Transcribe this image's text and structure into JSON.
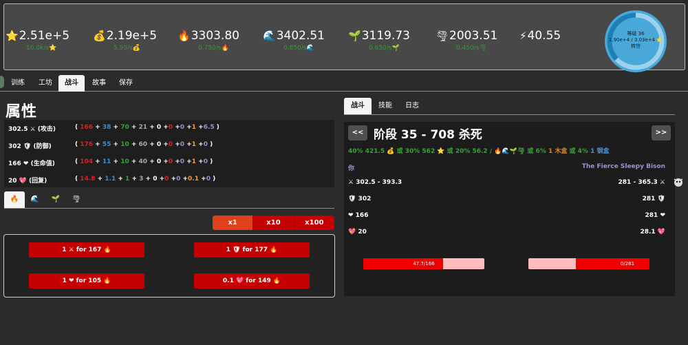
{
  "resources": [
    {
      "icon": "⭐",
      "value": "2.51e+5",
      "rate": "10.0k/s",
      "rate_icon": "⭐"
    },
    {
      "icon": "💰",
      "value": "2.19e+5",
      "rate": "5.95/s",
      "rate_icon": "💰"
    },
    {
      "icon": "🔥",
      "value": "3303.80",
      "rate": "0.750/s",
      "rate_icon": "🔥"
    },
    {
      "icon": "🌊",
      "value": "3402.51",
      "rate": "0.850/s",
      "rate_icon": "🌊"
    },
    {
      "icon": "🌱",
      "value": "3119.73",
      "rate": "0.650/s",
      "rate_icon": "🌱"
    },
    {
      "icon": "🌪",
      "value": "2003.51",
      "rate": "0.450/s",
      "rate_icon": "🌪"
    },
    {
      "icon": "⚡",
      "value": "40.55",
      "rate": "",
      "rate_icon": ""
    }
  ],
  "level": {
    "label": "等级 36",
    "xp": "1.90e+4 / 3.03e+4 ⭐",
    "action": "转世",
    "progress": 0.63,
    "colors": {
      "ring_bg": "#4aa8d8",
      "ring_track": "#1e7fb5",
      "ring_fill": "#9bd0ee"
    }
  },
  "main_tabs": [
    "训练",
    "工坊",
    "战斗",
    "故事",
    "保存"
  ],
  "main_tab_active": 2,
  "attributes_title": "属性",
  "stats": [
    {
      "name": "302.5 ⚔ (攻击)",
      "parts": [
        [
          "( ",
          "white"
        ],
        [
          "166",
          "red"
        ],
        [
          " + ",
          "white"
        ],
        [
          "38",
          "blue"
        ],
        [
          " + ",
          "white"
        ],
        [
          "70",
          "green"
        ],
        [
          " + ",
          "white"
        ],
        [
          "21",
          "gray"
        ],
        [
          " + 0 +",
          "white"
        ],
        [
          "0",
          "red"
        ],
        [
          " +",
          "white"
        ],
        [
          "0",
          "purple"
        ],
        [
          " +",
          "white"
        ],
        [
          "1",
          "orange"
        ],
        [
          " +",
          "white"
        ],
        [
          "6.5",
          "purple"
        ],
        [
          " )",
          "white"
        ]
      ]
    },
    {
      "name": "302 🛡 (防御)",
      "parts": [
        [
          "( ",
          "white"
        ],
        [
          "176",
          "red"
        ],
        [
          " + ",
          "white"
        ],
        [
          "55",
          "blue"
        ],
        [
          " + ",
          "white"
        ],
        [
          "10",
          "green"
        ],
        [
          " + ",
          "white"
        ],
        [
          "60",
          "gray"
        ],
        [
          " + 0 +",
          "white"
        ],
        [
          "0",
          "red"
        ],
        [
          " +",
          "white"
        ],
        [
          "0",
          "purple"
        ],
        [
          " +",
          "white"
        ],
        [
          "1",
          "orange"
        ],
        [
          " +",
          "white"
        ],
        [
          "0",
          "purple"
        ],
        [
          " )",
          "white"
        ]
      ]
    },
    {
      "name": "166 ❤ (生命值)",
      "parts": [
        [
          "( ",
          "white"
        ],
        [
          "104",
          "red"
        ],
        [
          " + ",
          "white"
        ],
        [
          "11",
          "blue"
        ],
        [
          " + ",
          "white"
        ],
        [
          "10",
          "green"
        ],
        [
          " + ",
          "white"
        ],
        [
          "40",
          "gray"
        ],
        [
          " + 0 +",
          "white"
        ],
        [
          "0",
          "red"
        ],
        [
          " +",
          "white"
        ],
        [
          "0",
          "purple"
        ],
        [
          " +",
          "white"
        ],
        [
          "1",
          "orange"
        ],
        [
          " +",
          "white"
        ],
        [
          "0",
          "purple"
        ],
        [
          " )",
          "white"
        ]
      ]
    },
    {
      "name": "20 💖 (回复)",
      "parts": [
        [
          "( ",
          "white"
        ],
        [
          "14.8",
          "red"
        ],
        [
          " + ",
          "white"
        ],
        [
          "1.1",
          "blue"
        ],
        [
          " + ",
          "white"
        ],
        [
          "1",
          "green"
        ],
        [
          " + ",
          "white"
        ],
        [
          "3",
          "gray"
        ],
        [
          " + 0 +",
          "white"
        ],
        [
          "0",
          "red"
        ],
        [
          " +",
          "white"
        ],
        [
          "0",
          "purple"
        ],
        [
          " +",
          "white"
        ],
        [
          "0.1",
          "orange"
        ],
        [
          " +",
          "white"
        ],
        [
          "0",
          "purple"
        ],
        [
          " )",
          "white"
        ]
      ]
    }
  ],
  "element_tabs": [
    "🔥",
    "🌊",
    "🌱",
    "🌪"
  ],
  "element_tab_active": 0,
  "multipliers": [
    "x1",
    "x10",
    "x100"
  ],
  "multiplier_active": 0,
  "upgrades": [
    {
      "label": "1 ⚔ for 167 🔥"
    },
    {
      "label": "1 🛡 for 177 🔥"
    },
    {
      "label": "1 ❤ for 105 🔥"
    },
    {
      "label": "0.1 💖 for 149 🔥"
    }
  ],
  "right_tabs": [
    "战斗",
    "技能",
    "日志"
  ],
  "right_tab_active": 0,
  "battle": {
    "prev": "<<",
    "next": ">>",
    "stage_title": "阶段 35 - 708 杀死",
    "loot": [
      [
        "40% 421.5 💰 或 30% 562 ⭐ 或 20% 56.2 / 🔥🌊🌱🌪 或 6% ",
        "green"
      ],
      [
        "1 木盒",
        "brown"
      ],
      [
        " 或 4% ",
        "green"
      ],
      [
        "1 钢盒",
        "steel"
      ]
    ],
    "player_label": "你",
    "enemy_label": "The Fierce Sleepy Bison",
    "player_stats": [
      "⚔ 302.5 - 393.3",
      "🛡 302",
      "❤ 166",
      "💖 20"
    ],
    "enemy_stats": [
      "281 - 365.3 ⚔",
      "281 🛡",
      "281 ❤",
      "28.1 💖"
    ],
    "player_hp_text": "47.7/166",
    "player_hp_fraction": 0.66,
    "enemy_hp_text": "0/281",
    "enemy_hp_fraction": 0.0,
    "enemy_fill_fraction": 0.37
  }
}
